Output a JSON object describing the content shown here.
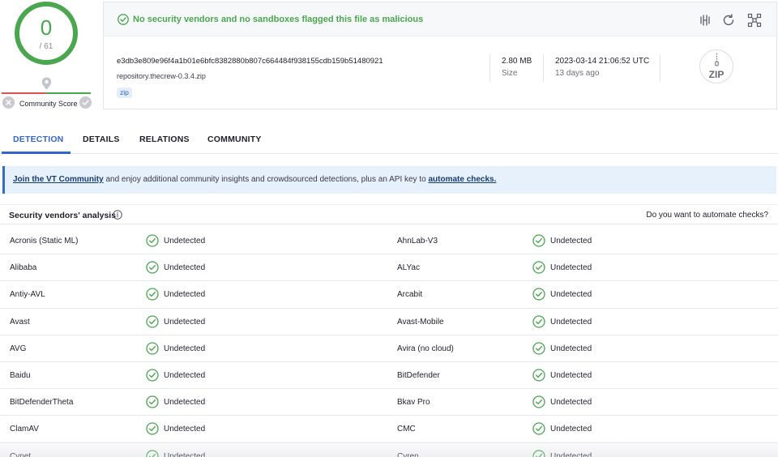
{
  "score": {
    "detections": "0",
    "total": "/ 61",
    "community_label": "Community Score"
  },
  "banner": {
    "message": "No security vendors and no sandboxes flagged this file as malicious"
  },
  "file": {
    "hash": "e3db3e809e96f4a1b01e6bfc8382880b807c664484f938155cdb159b51480921",
    "name": "repository.thecrew-0.3.4.zip",
    "tag": "zip",
    "size": "2.80 MB",
    "size_label": "Size",
    "date": "2023-03-14 21:06:52 UTC",
    "age": "13 days ago",
    "type_icon_label": "ZIP"
  },
  "tabs": [
    {
      "label": "DETECTION"
    },
    {
      "label": "DETAILS"
    },
    {
      "label": "RELATIONS"
    },
    {
      "label": "COMMUNITY"
    }
  ],
  "infobar": {
    "link1": "Join the VT Community",
    "middle": " and enjoy additional community insights and crowdsourced detections, plus an API key to ",
    "link2": "automate checks."
  },
  "section": {
    "title": "Security vendors' analysis",
    "right": "Do you want to automate checks?"
  },
  "vendors": [
    {
      "left": "Acronis (Static ML)",
      "left_result": "Undetected",
      "right": "AhnLab-V3",
      "right_result": "Undetected"
    },
    {
      "left": "Alibaba",
      "left_result": "Undetected",
      "right": "ALYac",
      "right_result": "Undetected"
    },
    {
      "left": "Antiy-AVL",
      "left_result": "Undetected",
      "right": "Arcabit",
      "right_result": "Undetected"
    },
    {
      "left": "Avast",
      "left_result": "Undetected",
      "right": "Avast-Mobile",
      "right_result": "Undetected"
    },
    {
      "left": "AVG",
      "left_result": "Undetected",
      "right": "Avira (no cloud)",
      "right_result": "Undetected"
    },
    {
      "left": "Baidu",
      "left_result": "Undetected",
      "right": "BitDefender",
      "right_result": "Undetected"
    },
    {
      "left": "BitDefenderTheta",
      "left_result": "Undetected",
      "right": "Bkav Pro",
      "right_result": "Undetected"
    },
    {
      "left": "ClamAV",
      "left_result": "Undetected",
      "right": "CMC",
      "right_result": "Undetected"
    },
    {
      "left": "Cynet",
      "left_result": "Undetected",
      "right": "Cyren",
      "right_result": "Undetected"
    }
  ],
  "colors": {
    "clean": "#4aa64f",
    "accent": "#3366cc",
    "malicious": "#d9534f"
  }
}
